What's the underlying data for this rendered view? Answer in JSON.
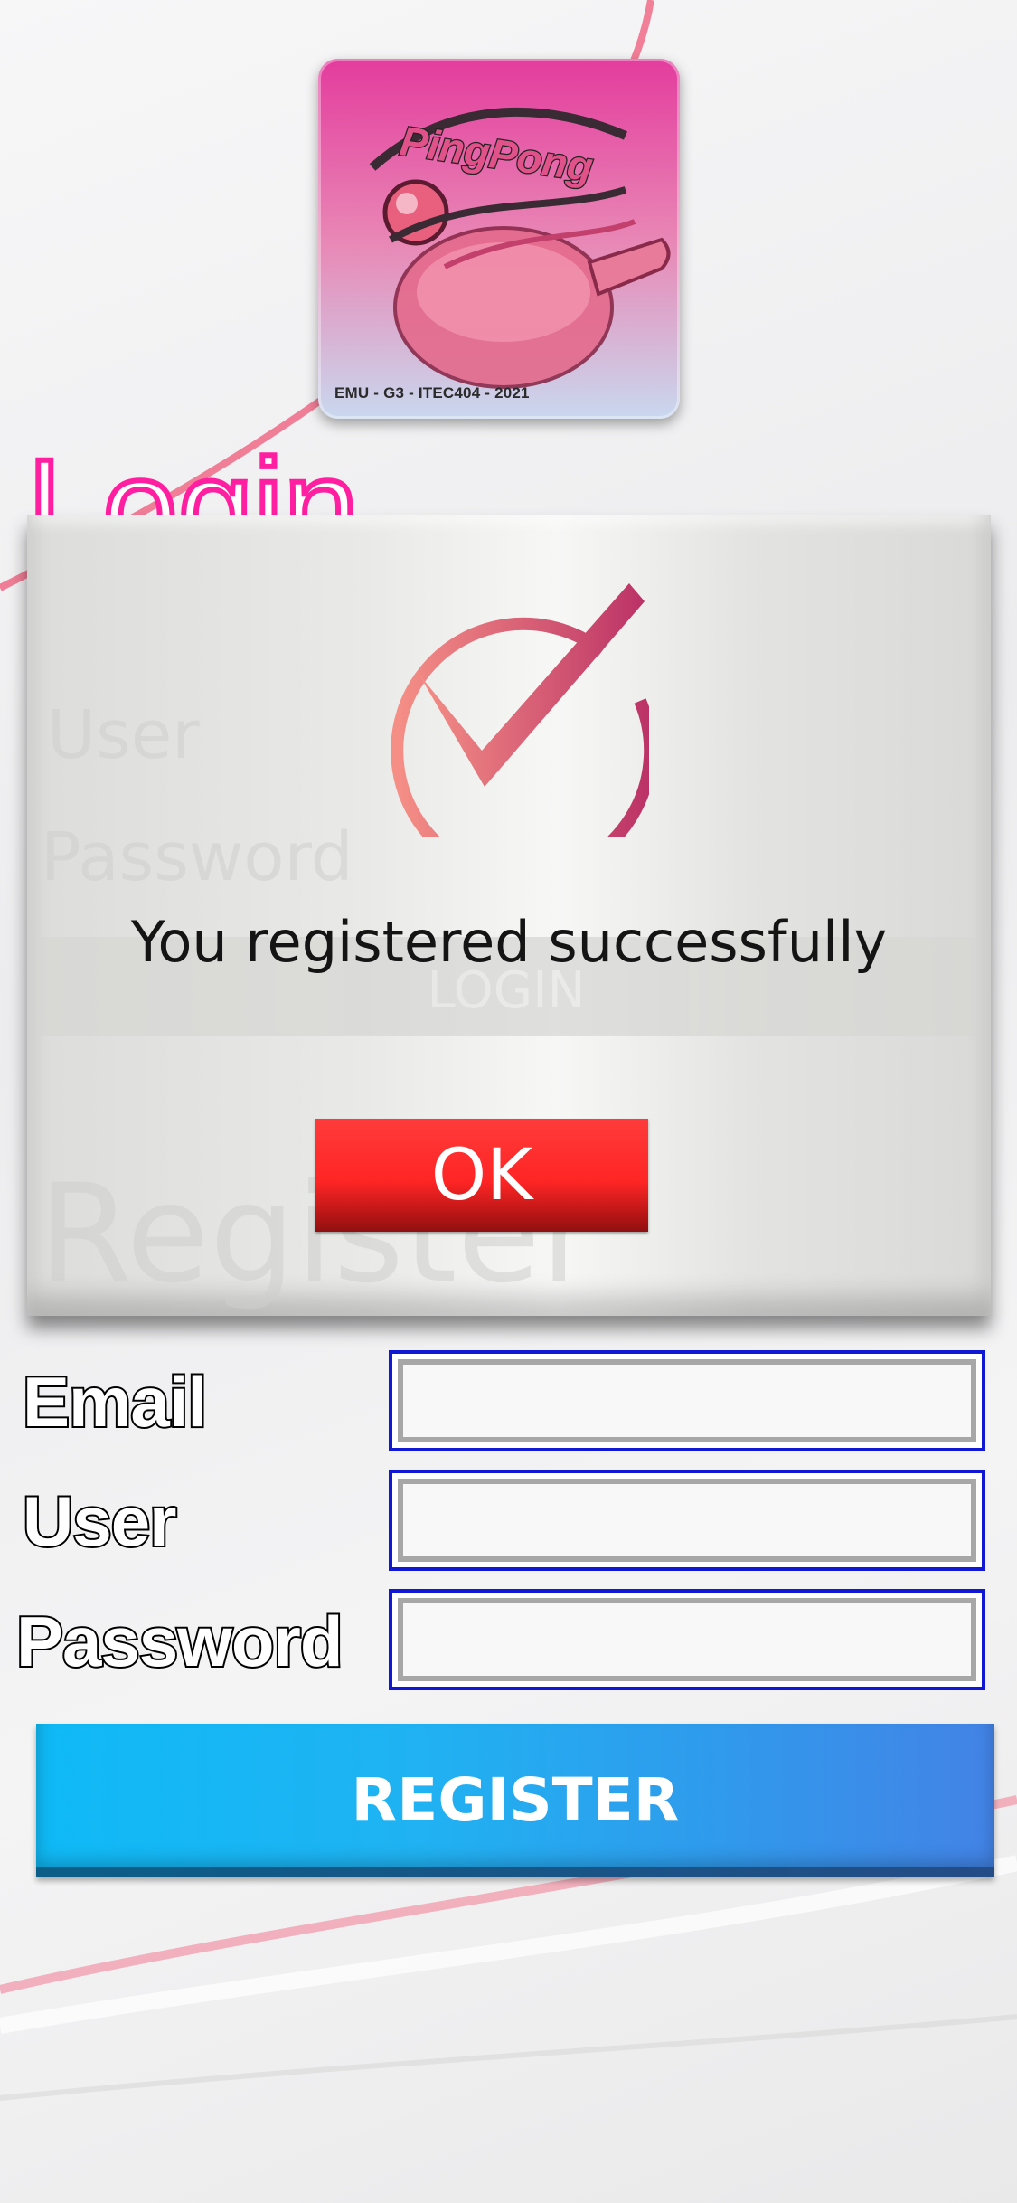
{
  "logo": {
    "brand_text": "PingPong",
    "caption": "EMU - G3 - ITEC404 - 2021"
  },
  "login": {
    "title": "Login",
    "user_label": "User",
    "password_label": "Password",
    "button_label": "LOGIN"
  },
  "dialog": {
    "icon": "check-circle-icon",
    "message": "You registered successfully",
    "ok_label": "OK"
  },
  "register": {
    "title": "Register",
    "email_label": "Email",
    "user_label": "User",
    "password_label": "Password",
    "email_value": "",
    "user_value": "",
    "password_value": "",
    "button_label": "REGISTER"
  },
  "colors": {
    "login_title_stroke": "#ff1fa0",
    "ok_button": "#ff2525",
    "register_button_start": "#0fbaf6",
    "register_button_end": "#4383e6",
    "input_border": "#1018d6",
    "check_icon_start": "#f58f86",
    "check_icon_end": "#bb3266"
  }
}
